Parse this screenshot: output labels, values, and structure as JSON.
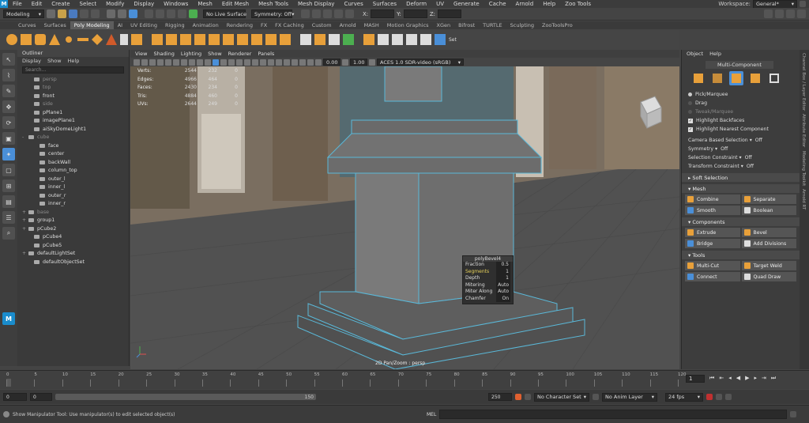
{
  "menubar": {
    "logo": "M",
    "items": [
      "File",
      "Edit",
      "Create",
      "Select",
      "Modify",
      "Display",
      "Windows",
      "Mesh",
      "Edit Mesh",
      "Mesh Tools",
      "Mesh Display",
      "Curves",
      "Surfaces",
      "Deform",
      "UV",
      "Generate",
      "Cache",
      "Arnold",
      "Help",
      "Zoo Tools"
    ],
    "workspace_label": "Workspace:",
    "workspace_value": "General*"
  },
  "statusline": {
    "mode": "Modeling",
    "live_surface": "No Live Surface",
    "symmetry": "Symmetry: Off",
    "x_label": "X:",
    "y_label": "Y:",
    "z_label": "Z:"
  },
  "shelf_tabs": [
    "Curves",
    "Surfaces",
    "Poly Modeling",
    "AI",
    "UV Editing",
    "Rigging",
    "Animation",
    "Rendering",
    "FX",
    "FX Caching",
    "Custom",
    "Arnold",
    "MASH",
    "Motion Graphics",
    "XGen",
    "Bifrost",
    "TURTLE",
    "Sculpting",
    "ZooToolsPro"
  ],
  "shelf_active": "Poly Modeling",
  "shelf_labels": {
    "set": "Set"
  },
  "outliner": {
    "title": "Outliner",
    "menu": [
      "Display",
      "Show",
      "Help"
    ],
    "search_placeholder": "Search...",
    "items": [
      {
        "label": "persp",
        "dim": true,
        "indent": 1,
        "exp": ""
      },
      {
        "label": "top",
        "dim": true,
        "indent": 1,
        "exp": ""
      },
      {
        "label": "front",
        "dim": false,
        "indent": 1,
        "exp": ""
      },
      {
        "label": "side",
        "dim": true,
        "indent": 1,
        "exp": ""
      },
      {
        "label": "pPlane1",
        "dim": false,
        "indent": 1,
        "exp": ""
      },
      {
        "label": "imagePlane1",
        "dim": false,
        "indent": 1,
        "exp": ""
      },
      {
        "label": "aiSkyDomeLight1",
        "dim": false,
        "indent": 1,
        "exp": ""
      },
      {
        "label": "cube",
        "dim": true,
        "indent": 0,
        "exp": "-"
      },
      {
        "label": "face",
        "dim": false,
        "indent": 2,
        "exp": ""
      },
      {
        "label": "center",
        "dim": false,
        "indent": 2,
        "exp": ""
      },
      {
        "label": "backWall",
        "dim": false,
        "indent": 2,
        "exp": ""
      },
      {
        "label": "column_top",
        "dim": false,
        "indent": 2,
        "exp": ""
      },
      {
        "label": "outer_l",
        "dim": false,
        "indent": 2,
        "exp": ""
      },
      {
        "label": "inner_l",
        "dim": false,
        "indent": 2,
        "exp": ""
      },
      {
        "label": "outer_r",
        "dim": false,
        "indent": 2,
        "exp": ""
      },
      {
        "label": "inner_r",
        "dim": false,
        "indent": 2,
        "exp": ""
      },
      {
        "label": "base",
        "dim": true,
        "indent": 0,
        "exp": "+"
      },
      {
        "label": "group1",
        "dim": false,
        "indent": 0,
        "exp": "+"
      },
      {
        "label": "pCube2",
        "dim": false,
        "indent": 0,
        "exp": "+"
      },
      {
        "label": "pCube4",
        "dim": false,
        "indent": 1,
        "exp": ""
      },
      {
        "label": "pCube5",
        "dim": false,
        "indent": 1,
        "exp": ""
      },
      {
        "label": "defaultLightSet",
        "dim": false,
        "indent": 0,
        "exp": "+"
      },
      {
        "label": "defaultObjectSet",
        "dim": false,
        "indent": 1,
        "exp": ""
      }
    ]
  },
  "viewport": {
    "menu": [
      "View",
      "Shading",
      "Lighting",
      "Show",
      "Renderer",
      "Panels"
    ],
    "exposure": "0.00",
    "gamma": "1.00",
    "color_space": "ACES 1.0 SDR-video (sRGB)",
    "hud": [
      {
        "k": "Verts:",
        "a": "2544",
        "b": "232",
        "c": "0"
      },
      {
        "k": "Edges:",
        "a": "4966",
        "b": "464",
        "c": "0"
      },
      {
        "k": "Faces:",
        "a": "2430",
        "b": "234",
        "c": "0"
      },
      {
        "k": "Tris:",
        "a": "4884",
        "b": "460",
        "c": "0"
      },
      {
        "k": "UVs:",
        "a": "2644",
        "b": "249",
        "c": "0"
      }
    ],
    "camera_label": "2D Pan/Zoom : persp"
  },
  "bevel": {
    "title": "polyBevel4",
    "rows": [
      {
        "k": "Fraction",
        "v": "0.5",
        "hl": false
      },
      {
        "k": "Segments",
        "v": "1",
        "hl": true
      },
      {
        "k": "Depth",
        "v": "1",
        "hl": false
      },
      {
        "k": "Mitering",
        "v": "Auto",
        "hl": false
      },
      {
        "k": "Miter Along",
        "v": "Auto",
        "hl": false
      },
      {
        "k": "Chamfer",
        "v": "On",
        "hl": false
      }
    ]
  },
  "modeling_toolkit": {
    "menu": [
      "Object",
      "Help"
    ],
    "mode": "Multi-Component",
    "options": [
      {
        "label": "Pick/Marquee",
        "type": "radio",
        "on": true,
        "dim": false
      },
      {
        "label": "Drag",
        "type": "radio",
        "on": false,
        "dim": false
      },
      {
        "label": "Tweak/Marquee",
        "type": "radio",
        "on": false,
        "dim": true
      },
      {
        "label": "Highlight Backfaces",
        "type": "check",
        "on": true,
        "dim": false
      },
      {
        "label": "Highlight Nearest Component",
        "type": "check",
        "on": true,
        "dim": false
      }
    ],
    "camera_based": "Camera Based Selection",
    "camera_based_val": "Off",
    "symmetry": "Symmetry",
    "symmetry_val": "Off",
    "sel_constraint": "Selection Constraint",
    "sel_constraint_val": "Off",
    "xform_constraint": "Transform Constraint",
    "xform_constraint_val": "Off",
    "soft_selection": "Soft Selection",
    "sections": [
      {
        "title": "Mesh",
        "buttons": [
          [
            "Combine",
            "Separate"
          ],
          [
            "Smooth",
            "Boolean"
          ]
        ]
      },
      {
        "title": "Components",
        "buttons": [
          [
            "Extrude",
            "Bevel"
          ],
          [
            "Bridge",
            "Add Divisions"
          ]
        ]
      },
      {
        "title": "Tools",
        "buttons": [
          [
            "Multi-Cut",
            "Target Weld"
          ],
          [
            "Connect",
            "Quad Draw"
          ]
        ]
      }
    ],
    "side_tabs": [
      "Channel Box / Layer Editor",
      "Attribute Editor",
      "Modeling Toolkit",
      "Arnold RT"
    ]
  },
  "timeline": {
    "ticks": [
      "0",
      "5",
      "10",
      "15",
      "20",
      "25",
      "30",
      "35",
      "40",
      "45",
      "50",
      "55",
      "60",
      "65",
      "70",
      "75",
      "80",
      "85",
      "90",
      "95",
      "100",
      "105",
      "110",
      "115",
      "120"
    ],
    "current": "1"
  },
  "range": {
    "start": "0",
    "start_inner": "0",
    "end_inner": "150",
    "end": "250",
    "char_set": "No Character Set",
    "anim_layer": "No Anim Layer",
    "fps": "24 fps"
  },
  "cmdline": {
    "help": "Show Manipulator Tool: Use manipulator(s) to edit selected object(s)",
    "lang": "MEL"
  }
}
